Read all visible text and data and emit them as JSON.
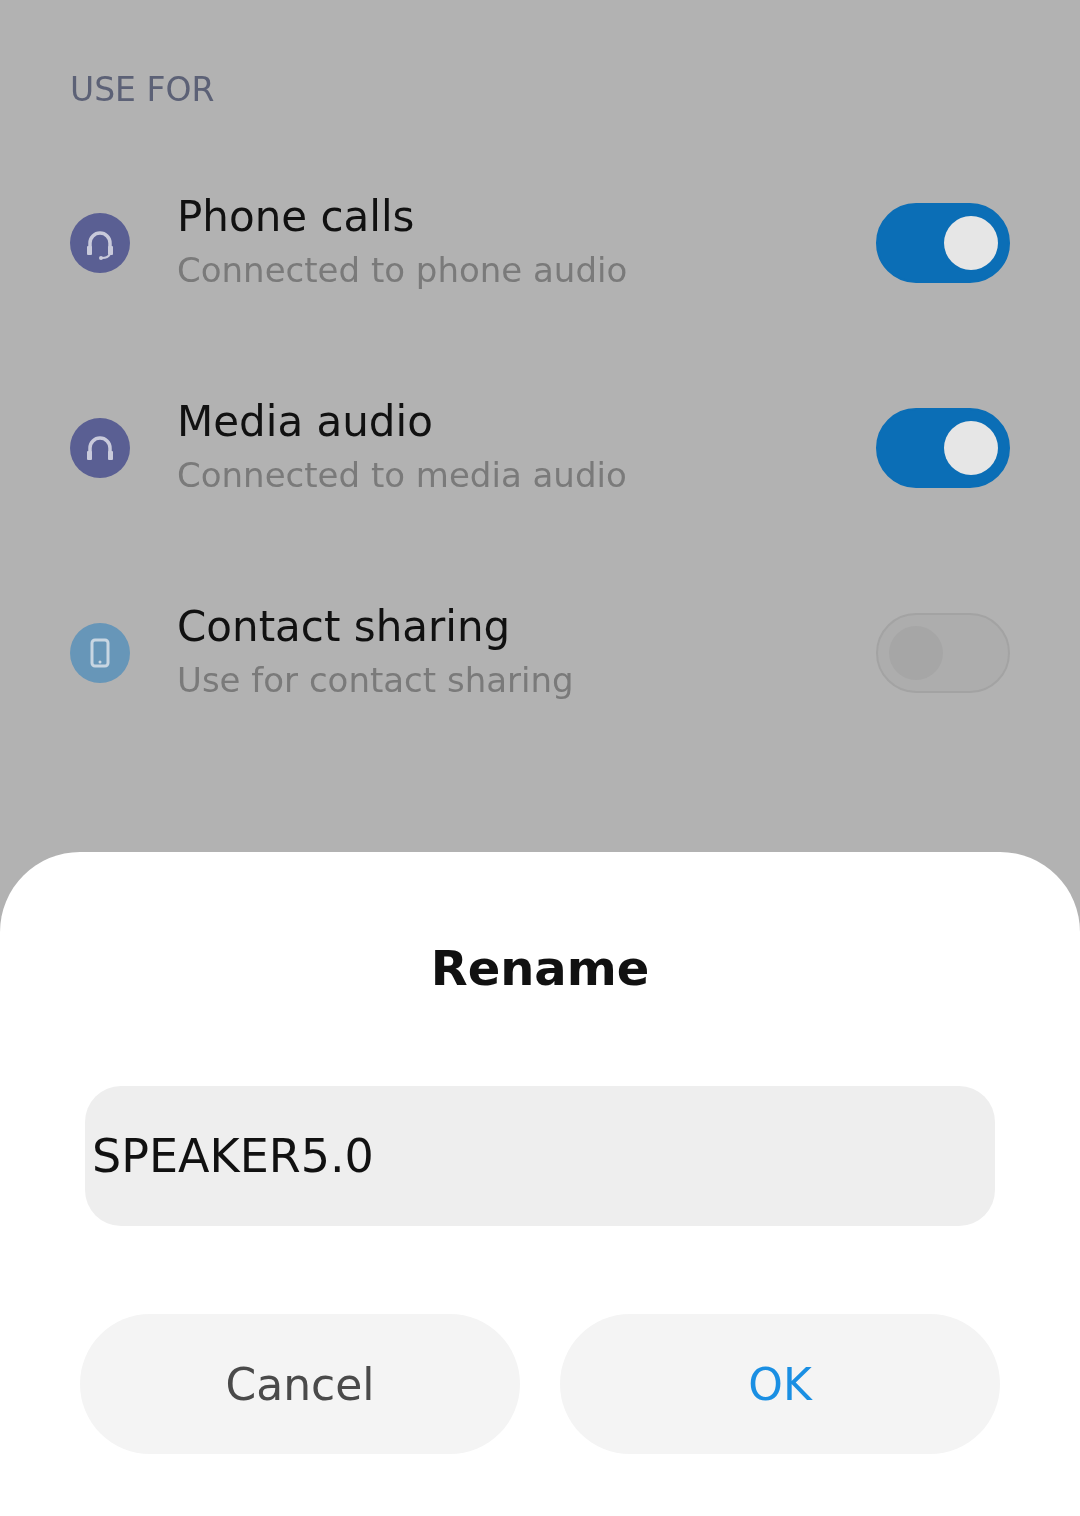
{
  "section_header": "USE FOR",
  "items": [
    {
      "kind": "headset",
      "color": "#5a5f93",
      "title": "Phone calls",
      "subtitle": "Connected to phone audio",
      "on": true
    },
    {
      "kind": "headphones",
      "color": "#5a5f93",
      "title": "Media audio",
      "subtitle": "Connected to media audio",
      "on": true
    },
    {
      "kind": "phone",
      "color": "#6796b8",
      "title": "Contact sharing",
      "subtitle": "Use for contact sharing",
      "on": false
    }
  ],
  "dialog": {
    "title": "Rename",
    "field": {
      "value": "SPEAKER5.0"
    },
    "buttons": [
      {
        "label": "Cancel",
        "kind": "cancel"
      },
      {
        "label": "OK",
        "kind": "confirm"
      }
    ]
  }
}
